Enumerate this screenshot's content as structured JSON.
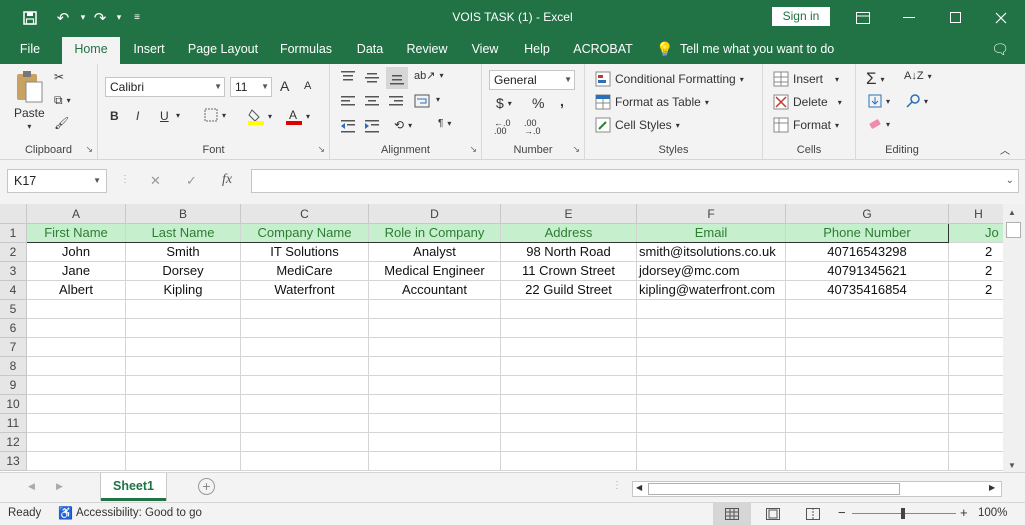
{
  "window": {
    "title": "VOIS TASK (1)  -  Excel",
    "sign_in": "Sign in",
    "qat": {
      "save_icon": "save-icon",
      "undo_icon": "undo-icon",
      "redo_icon": "redo-icon",
      "customize_icon": "customize-qat-icon"
    }
  },
  "tabs": [
    "File",
    "Home",
    "Insert",
    "Page Layout",
    "Formulas",
    "Data",
    "Review",
    "View",
    "Help",
    "ACROBAT"
  ],
  "active_tab": "Home",
  "tell_me": "Tell me what you want to do",
  "ribbon": {
    "clipboard": {
      "paste": "Paste",
      "label": "Clipboard"
    },
    "font": {
      "name": "Calibri",
      "size": "11",
      "bold": "B",
      "italic": "I",
      "underline": "U",
      "grow": "A",
      "shrink": "A",
      "label": "Font"
    },
    "alignment": {
      "label": "Alignment"
    },
    "number": {
      "format": "General",
      "currency": "$",
      "percent": "%",
      "comma": ",",
      "label": "Number"
    },
    "styles": {
      "conditional": "Conditional Formatting",
      "format_table": "Format as Table",
      "cell_styles": "Cell Styles",
      "label": "Styles"
    },
    "cells": {
      "insert": "Insert",
      "delete": "Delete",
      "format": "Format",
      "label": "Cells"
    },
    "editing": {
      "label": "Editing"
    }
  },
  "formula_bar": {
    "name_box": "K17",
    "fx": "fx",
    "value": ""
  },
  "grid": {
    "columns": [
      "A",
      "B",
      "C",
      "D",
      "E",
      "F",
      "G",
      "H"
    ],
    "rows": [
      "1",
      "2",
      "3",
      "4",
      "5",
      "6",
      "7",
      "8",
      "9",
      "10",
      "11",
      "12",
      "13"
    ],
    "header_row": [
      "First Name",
      "Last Name",
      "Company Name",
      "Role in Company",
      "Address",
      "Email",
      "Phone Number",
      "Jo"
    ],
    "data": [
      [
        "John",
        "Smith",
        "IT Solutions",
        "Analyst",
        "98 North Road",
        "smith@itsolutions.co.uk",
        "40716543298",
        "2"
      ],
      [
        "Jane",
        "Dorsey",
        "MediCare",
        "Medical Engineer",
        "11 Crown Street",
        "jdorsey@mc.com",
        "40791345621",
        "2"
      ],
      [
        "Albert",
        "Kipling",
        "Waterfront",
        "Accountant",
        "22 Guild Street",
        "kipling@waterfront.com",
        "40735416854",
        "2"
      ]
    ]
  },
  "sheet_tab": "Sheet1",
  "status": {
    "ready": "Ready",
    "accessibility": "Accessibility: Good to go",
    "zoom": "100%"
  },
  "colors": {
    "brand": "#217346",
    "header_fill": "#c6efce",
    "header_text": "#2e7d32"
  }
}
